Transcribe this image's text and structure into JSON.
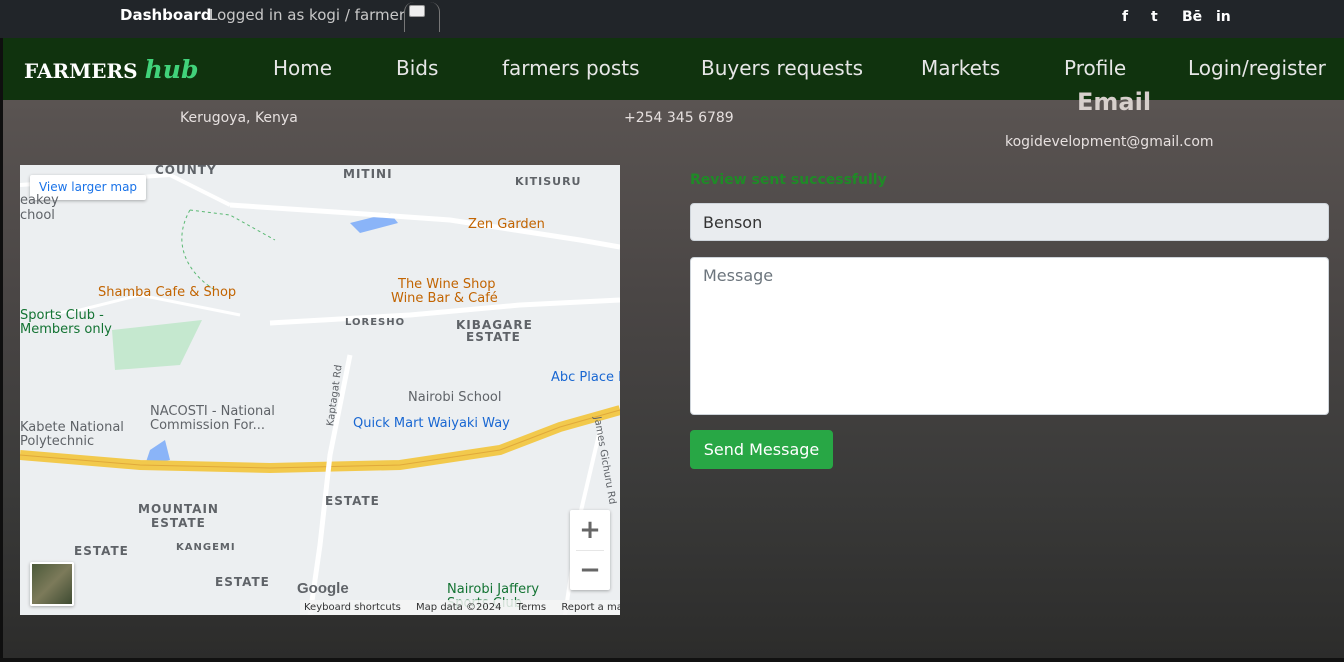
{
  "topbar": {
    "dashboard": "Dashboard",
    "logged_in": "Logged in as kogi / farmer",
    "social": [
      "f",
      "t",
      "Bē",
      "in"
    ]
  },
  "nav": {
    "brand_main": "FARMERS",
    "brand_accent": "hub",
    "links": [
      "Home",
      "Bids",
      "farmers posts",
      "Buyers requests",
      "Markets",
      "Profile",
      "Login/register"
    ]
  },
  "contact": {
    "address": "Kerugoya, Kenya",
    "phone": "+254 345 6789",
    "email_heading": "Email",
    "email": "kogidevelopment@gmail.com"
  },
  "form": {
    "success": "Review sent successfully",
    "name_value": "Benson",
    "message_placeholder": "Message",
    "send_label": "Send Message"
  },
  "map": {
    "view_larger": "View larger map",
    "google": "Google",
    "attribution": [
      "Keyboard shortcuts",
      "Map data ©2024",
      "Terms",
      "Report a map error"
    ],
    "labels": {
      "county": "COUNTY",
      "mitini": "MITINI",
      "kitisuru": "KITISURU",
      "keeley": "eakey",
      "school": "chool",
      "zen_garden": "Zen Garden",
      "shamba": "Shamba Cafe & Shop",
      "wine_shop": "The Wine Shop",
      "wine_bar": "Wine Bar & Café",
      "sports_club": "Sports Club -",
      "members_only": "Members only",
      "loresho": "LORESHO",
      "kibagare": "KIBAGARE",
      "estate1": "ESTATE",
      "abc_place": "Abc Place M",
      "kaptagat": "Kaptagat Rd",
      "nacosti": "NACOSTI - National",
      "commission": "Commission For...",
      "nairobi_school": "Nairobi School",
      "kabete": "Kabete National",
      "polytechnic": "Polytechnic",
      "quick_mart": "Quick Mart Waiyaki Way",
      "james_gichuru": "James Gichuru Rd",
      "mountain": "MOUNTAIN",
      "estate2": "ESTATE",
      "estate3": "ESTATE",
      "estate4": "ESTATE",
      "kangemi": "KANGEMI",
      "estate5": "ESTATE",
      "jaffery": "Nairobi Jaffery",
      "sports_club2": "Sports Club"
    }
  }
}
